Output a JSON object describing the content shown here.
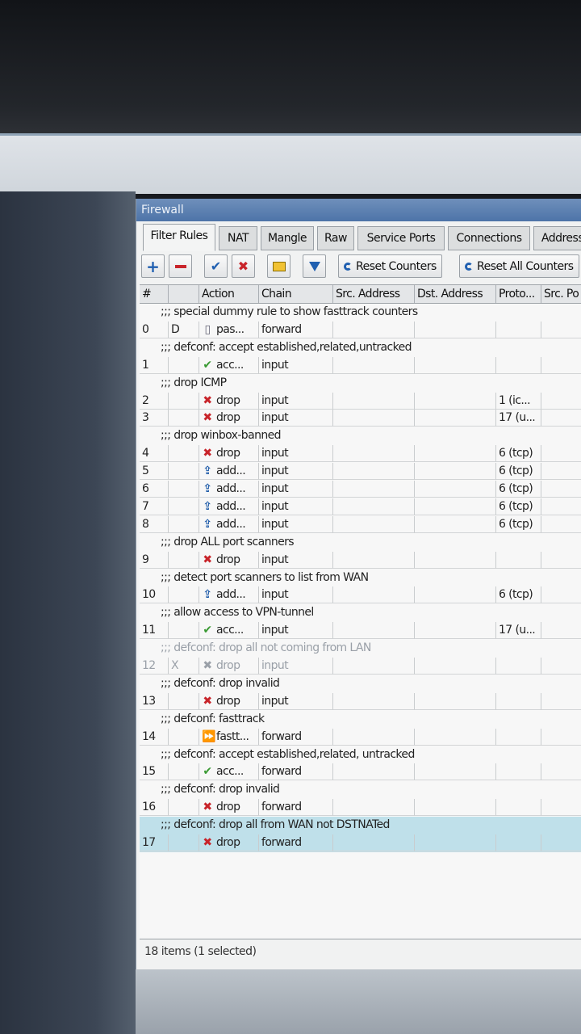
{
  "window": {
    "title": "Firewall"
  },
  "tabs": [
    "Filter Rules",
    "NAT",
    "Mangle",
    "Raw",
    "Service Ports",
    "Connections",
    "Address"
  ],
  "toolbar": {
    "reset_counters": "Reset Counters",
    "reset_all_counters": "Reset All Counters"
  },
  "columns": [
    "#",
    "",
    "Action",
    "Chain",
    "Src. Address",
    "Dst. Address",
    "Proto...",
    "Src. Po"
  ],
  "rows": [
    {
      "comment": ";;; special dummy rule to show fasttrack counters"
    },
    {
      "num": "0",
      "flag": "D",
      "icon": "pass-icon",
      "action": "pas...",
      "chain": "forward",
      "proto": ""
    },
    {
      "comment": ";;; defconf: accept established,related,untracked"
    },
    {
      "num": "1",
      "flag": "",
      "icon": "accept-icon",
      "action": "acc...",
      "chain": "input",
      "proto": ""
    },
    {
      "comment": ";;; drop ICMP"
    },
    {
      "num": "2",
      "flag": "",
      "icon": "drop-icon",
      "action": "drop",
      "chain": "input",
      "proto": "1 (ic..."
    },
    {
      "num": "3",
      "flag": "",
      "icon": "drop-icon",
      "action": "drop",
      "chain": "input",
      "proto": "17 (u..."
    },
    {
      "comment": ";;; drop winbox-banned"
    },
    {
      "num": "4",
      "flag": "",
      "icon": "drop-icon",
      "action": "drop",
      "chain": "input",
      "proto": "6 (tcp)"
    },
    {
      "num": "5",
      "flag": "",
      "icon": "add-icon",
      "action": "add...",
      "chain": "input",
      "proto": "6 (tcp)"
    },
    {
      "num": "6",
      "flag": "",
      "icon": "add-icon",
      "action": "add...",
      "chain": "input",
      "proto": "6 (tcp)"
    },
    {
      "num": "7",
      "flag": "",
      "icon": "add-icon",
      "action": "add...",
      "chain": "input",
      "proto": "6 (tcp)"
    },
    {
      "num": "8",
      "flag": "",
      "icon": "add-icon",
      "action": "add...",
      "chain": "input",
      "proto": "6 (tcp)"
    },
    {
      "comment": ";;; drop ALL port scanners"
    },
    {
      "num": "9",
      "flag": "",
      "icon": "drop-icon",
      "action": "drop",
      "chain": "input",
      "proto": ""
    },
    {
      "comment": ";;; detect port scanners to list from WAN"
    },
    {
      "num": "10",
      "flag": "",
      "icon": "add-icon",
      "action": "add...",
      "chain": "input",
      "proto": "6 (tcp)"
    },
    {
      "comment": ";;; allow access to VPN-tunnel"
    },
    {
      "num": "11",
      "flag": "",
      "icon": "accept-icon",
      "action": "acc...",
      "chain": "input",
      "proto": "17 (u..."
    },
    {
      "comment": ";;; defconf: drop all not coming from LAN",
      "disabled": true
    },
    {
      "num": "12",
      "flag": "X",
      "icon": "drop-icon",
      "action": "drop",
      "chain": "input",
      "proto": "",
      "disabled": true
    },
    {
      "comment": ";;; defconf: drop invalid"
    },
    {
      "num": "13",
      "flag": "",
      "icon": "drop-icon",
      "action": "drop",
      "chain": "input",
      "proto": ""
    },
    {
      "comment": ";;; defconf: fasttrack"
    },
    {
      "num": "14",
      "flag": "",
      "icon": "fasttrack-icon",
      "action": "fastt...",
      "chain": "forward",
      "proto": ""
    },
    {
      "comment": ";;; defconf: accept established,related, untracked"
    },
    {
      "num": "15",
      "flag": "",
      "icon": "accept-icon",
      "action": "acc...",
      "chain": "forward",
      "proto": ""
    },
    {
      "comment": ";;; defconf: drop invalid"
    },
    {
      "num": "16",
      "flag": "",
      "icon": "drop-icon",
      "action": "drop",
      "chain": "forward",
      "proto": ""
    },
    {
      "comment": ";;; defconf: drop all from WAN not DSTNATed",
      "selected": true
    },
    {
      "num": "17",
      "flag": "",
      "icon": "drop-icon",
      "action": "drop",
      "chain": "forward",
      "proto": "",
      "selected": true
    }
  ],
  "status": "18 items (1 selected)"
}
